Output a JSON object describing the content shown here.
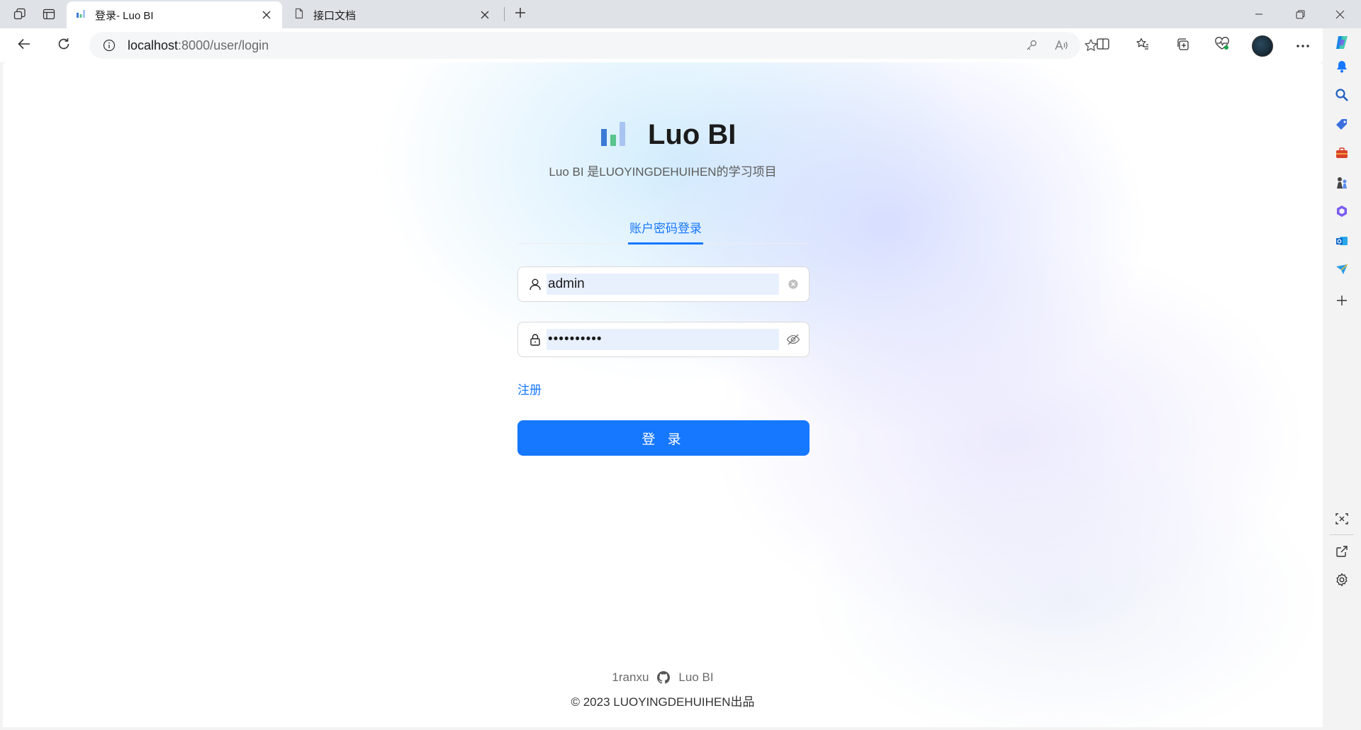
{
  "browser": {
    "tabs": [
      {
        "title": "登录- Luo BI",
        "active": true,
        "icon": "bar-chart-favicon"
      },
      {
        "title": "接口文档",
        "active": false,
        "icon": "document-icon"
      }
    ],
    "address": {
      "host": "localhost",
      "path": ":8000/user/login"
    }
  },
  "page": {
    "app_title": "Luo BI",
    "subtitle": "Luo BI 是LUOYINGDEHUIHEN的学习项目",
    "login_tab_label": "账户密码登录",
    "username_value": "admin",
    "password_mask": "••••••••••",
    "register_link": "注册",
    "login_button": "登 录",
    "footer": {
      "author": "1ranxu",
      "project_link": "Luo BI",
      "copyright": "© 2023 LUOYINGDEHUIHEN出品"
    }
  },
  "colors": {
    "primary": "#1677ff",
    "logo_bar_1": "#3a7bd5",
    "logo_bar_2": "#59c48c",
    "logo_bar_3": "#a9c4f2"
  }
}
